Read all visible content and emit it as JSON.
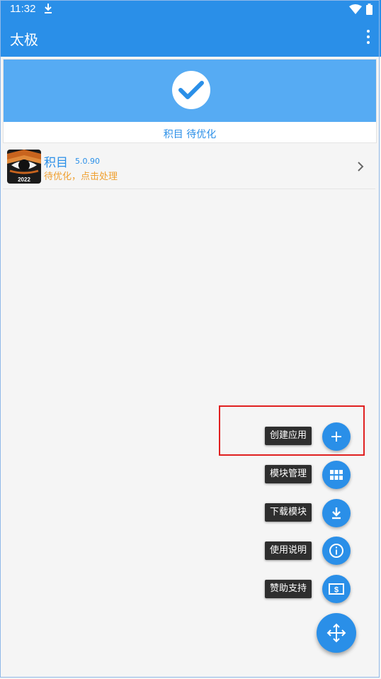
{
  "status_bar": {
    "time": "11:32"
  },
  "app_bar": {
    "title": "太极"
  },
  "status_card": {
    "text": "积目 待优化"
  },
  "app_list": [
    {
      "name": "积目",
      "version": "5.0.90",
      "status": "待优化，点击处理",
      "icon_badge": "2022"
    }
  ],
  "fab_menu": [
    {
      "label": "创建应用",
      "icon": "plus-icon"
    },
    {
      "label": "模块管理",
      "icon": "grid-icon"
    },
    {
      "label": "下载模块",
      "icon": "download-icon"
    },
    {
      "label": "使用说明",
      "icon": "info-icon"
    },
    {
      "label": "赞助支持",
      "icon": "money-icon"
    }
  ],
  "colors": {
    "primary": "#2a8fe8",
    "banner": "#56abf3",
    "warning": "#f0a030",
    "highlight": "#e02020"
  }
}
